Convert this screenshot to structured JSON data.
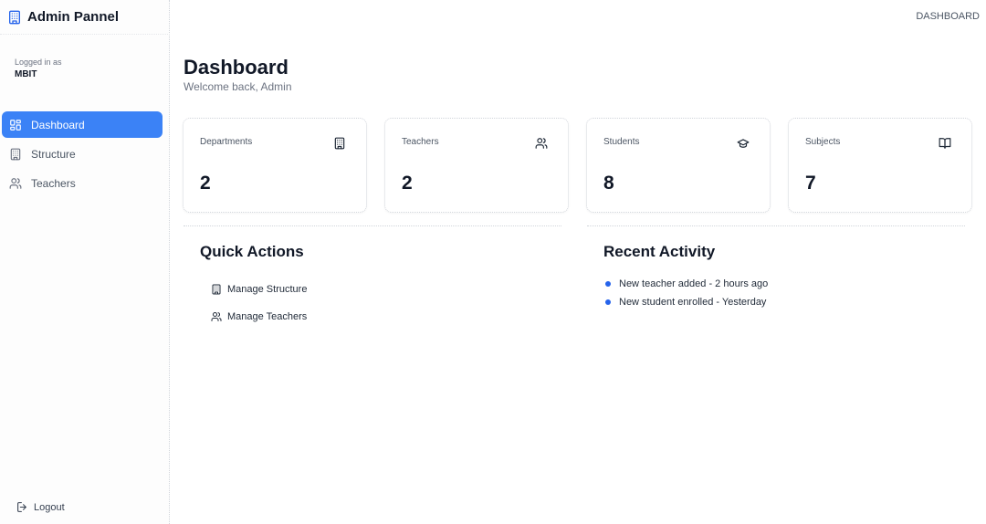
{
  "app": {
    "title": "Admin Pannel",
    "brand_icon": "building-icon",
    "accent_color": "#3b82f6"
  },
  "sidebar": {
    "login_label": "Logged in as",
    "user": "MBIT",
    "items": [
      {
        "label": "Dashboard",
        "icon": "dashboard-grid-icon",
        "active": true
      },
      {
        "label": "Structure",
        "icon": "building-icon",
        "active": false
      },
      {
        "label": "Teachers",
        "icon": "users-icon",
        "active": false
      }
    ],
    "logout_label": "Logout"
  },
  "topbar": {
    "breadcrumb": "DASHBOARD"
  },
  "main": {
    "title": "Dashboard",
    "subtitle": "Welcome back, Admin",
    "stats": [
      {
        "label": "Departments",
        "value": "2",
        "icon": "building-icon"
      },
      {
        "label": "Teachers",
        "value": "2",
        "icon": "users-icon"
      },
      {
        "label": "Students",
        "value": "8",
        "icon": "graduation-cap-icon"
      },
      {
        "label": "Subjects",
        "value": "7",
        "icon": "book-open-icon"
      }
    ],
    "quick_actions": {
      "title": "Quick Actions",
      "items": [
        {
          "label": "Manage Structure",
          "icon": "building-icon"
        },
        {
          "label": "Manage Teachers",
          "icon": "users-icon"
        }
      ]
    },
    "recent_activity": {
      "title": "Recent Activity",
      "dot_color": "#2563eb",
      "items": [
        "New teacher added - 2 hours ago",
        "New student enrolled - Yesterday"
      ]
    }
  }
}
